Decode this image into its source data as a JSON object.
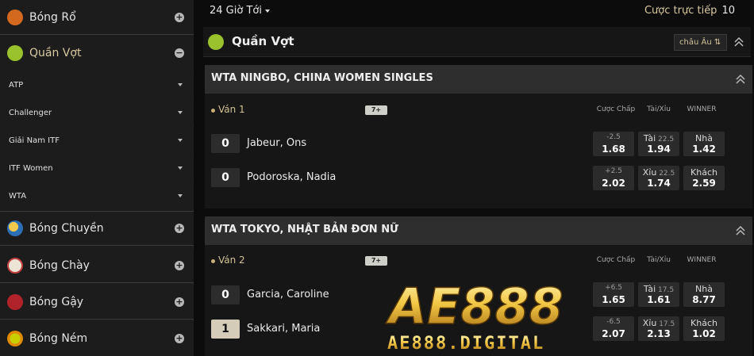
{
  "sidebar": {
    "sports": [
      {
        "label": "Bóng Rổ",
        "icon": "basketball-icon",
        "color": "#d2691e"
      },
      {
        "label": "Quần Vợt",
        "icon": "tennis-ball-icon",
        "color": "#9ac22c",
        "expanded": true
      },
      {
        "label": "Bóng Chuyền",
        "icon": "volleyball-icon",
        "color": "#2d6fb5"
      },
      {
        "label": "Bóng Chày",
        "icon": "baseball-icon",
        "color": "#e8e0d0"
      },
      {
        "label": "Bóng Gậy",
        "icon": "cricket-ball-icon",
        "color": "#b0232a"
      },
      {
        "label": "Bóng Ném",
        "icon": "handball-icon",
        "color": "#c8d000"
      }
    ],
    "tennis_subs": [
      "ATP",
      "Challenger",
      "Giải Nam ITF",
      "ITF Women",
      "WTA"
    ],
    "expand_symbol": "+",
    "collapse_symbol": "−"
  },
  "topbar": {
    "time_filter": "24 Giờ Tới",
    "live_label": "Cược trực tiếp",
    "live_count": "10"
  },
  "sport_header": {
    "title": "Quần Vợt",
    "odds_format": "châu Âu ⇅"
  },
  "columns": {
    "handicap": "Cược Chấp",
    "over_under": "Tài/Xỉu",
    "winner": "WINNER"
  },
  "leagues": [
    {
      "title": "WTA NINGBO, CHINA WOMEN SINGLES",
      "round": "Ván 1",
      "badge": "7+",
      "players": [
        {
          "score": "0",
          "name": "Jabeur, Ons",
          "hcp_line": "-2.5",
          "hcp_price": "1.68",
          "ou_label": "Tài",
          "ou_line": "22.5",
          "ou_price": "1.94",
          "win_label": "Nhà",
          "win_price": "1.42"
        },
        {
          "score": "0",
          "name": "Podoroska, Nadia",
          "hcp_line": "+2.5",
          "hcp_price": "2.02",
          "ou_label": "Xỉu",
          "ou_line": "22.5",
          "ou_price": "1.74",
          "win_label": "Khách",
          "win_price": "2.59"
        }
      ]
    },
    {
      "title": "WTA TOKYO, NHẬT BẢN ĐƠN NỮ",
      "round": "Ván 2",
      "badge": "7+",
      "players": [
        {
          "score": "0",
          "name": "Garcia, Caroline",
          "hcp_line": "+6.5",
          "hcp_price": "1.65",
          "ou_label": "Tài",
          "ou_line": "17.5",
          "ou_price": "1.61",
          "win_label": "Nhà",
          "win_price": "8.77"
        },
        {
          "score": "1",
          "name": "Sakkari, Maria",
          "hcp_line": "-6.5",
          "hcp_price": "2.07",
          "ou_label": "Xỉu",
          "ou_line": "17.5",
          "ou_price": "2.13",
          "win_label": "Khách",
          "win_price": "1.02"
        }
      ]
    }
  ],
  "watermark": {
    "logo_text": "AE888",
    "domain_text": "AE888.DIGITAL"
  }
}
